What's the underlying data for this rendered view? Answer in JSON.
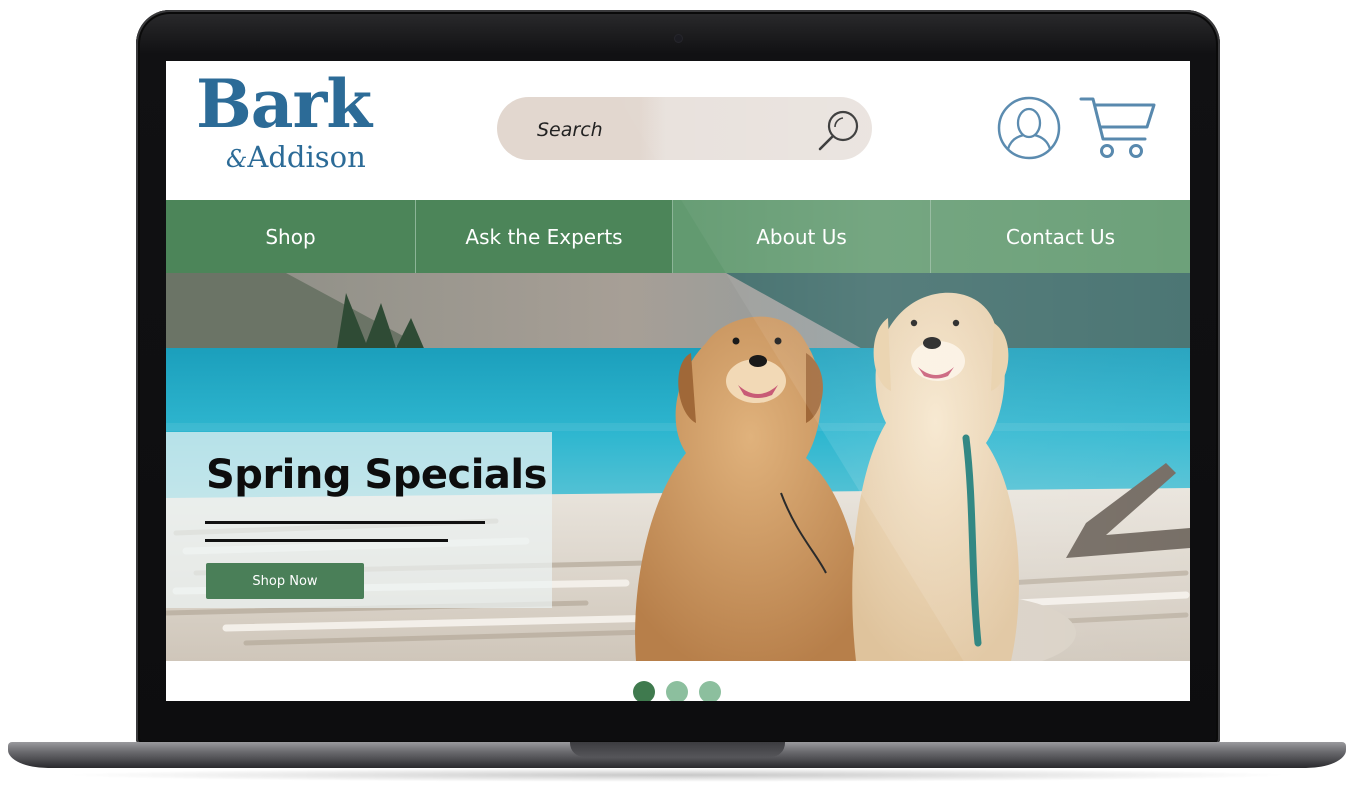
{
  "brand": {
    "name_main": "Bark",
    "name_amp": "&",
    "name_sub": "Addison"
  },
  "search": {
    "placeholder": "Search"
  },
  "nav": {
    "items": [
      {
        "label": "Shop"
      },
      {
        "label": "Ask the Experts"
      },
      {
        "label": "About Us"
      },
      {
        "label": "Contact Us"
      }
    ]
  },
  "hero": {
    "title": "Spring Specials",
    "button_label": "Shop Now"
  },
  "carousel": {
    "slide_count": 3,
    "active_index": 0
  },
  "colors": {
    "brand_blue": "#2c6b97",
    "nav_green": "#4c8559",
    "button_green": "#4a7f58",
    "dot_active": "#3f7a4e",
    "dot_inactive": "#8cbf9e"
  },
  "icons": {
    "search": "search-icon",
    "account": "user-icon",
    "cart": "cart-icon"
  }
}
